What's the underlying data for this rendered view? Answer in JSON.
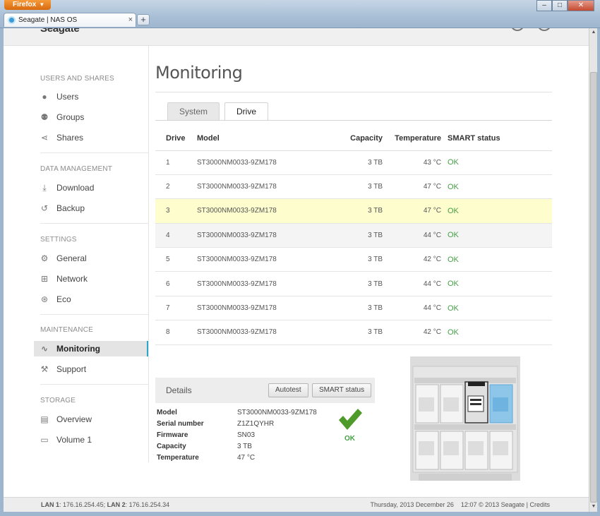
{
  "browser": {
    "app_button": "Firefox",
    "tab_title": "Seagate | NAS OS",
    "tab_close": "×",
    "new_tab": "+",
    "window_controls": [
      "–",
      "□",
      "✕"
    ]
  },
  "header": {
    "logo": "Seagate"
  },
  "sidebar": {
    "sections": [
      {
        "title": "USERS AND SHARES",
        "items": [
          {
            "label": "Users",
            "icon": "user-icon"
          },
          {
            "label": "Groups",
            "icon": "group-icon"
          },
          {
            "label": "Shares",
            "icon": "share-icon"
          }
        ]
      },
      {
        "title": "DATA MANAGEMENT",
        "items": [
          {
            "label": "Download",
            "icon": "download-icon"
          },
          {
            "label": "Backup",
            "icon": "backup-icon"
          }
        ]
      },
      {
        "title": "SETTINGS",
        "items": [
          {
            "label": "General",
            "icon": "gear-icon"
          },
          {
            "label": "Network",
            "icon": "network-icon"
          },
          {
            "label": "Eco",
            "icon": "eco-icon"
          }
        ]
      },
      {
        "title": "MAINTENANCE",
        "items": [
          {
            "label": "Monitoring",
            "icon": "pulse-icon",
            "active": true
          },
          {
            "label": "Support",
            "icon": "wrench-icon"
          }
        ]
      },
      {
        "title": "STORAGE",
        "items": [
          {
            "label": "Overview",
            "icon": "drive-icon"
          },
          {
            "label": "Volume 1",
            "icon": "volume-icon"
          }
        ]
      }
    ]
  },
  "main": {
    "title": "Monitoring",
    "tabs": [
      {
        "label": "System",
        "active": false
      },
      {
        "label": "Drive",
        "active": true
      }
    ],
    "table": {
      "headers": {
        "drive": "Drive",
        "model": "Model",
        "capacity": "Capacity",
        "temperature": "Temperature",
        "smart": "SMART status"
      },
      "rows": [
        {
          "drive": "1",
          "model": "ST3000NM0033-9ZM178",
          "capacity": "3 TB",
          "temperature": "43 °C",
          "smart": "OK"
        },
        {
          "drive": "2",
          "model": "ST3000NM0033-9ZM178",
          "capacity": "3 TB",
          "temperature": "47 °C",
          "smart": "OK"
        },
        {
          "drive": "3",
          "model": "ST3000NM0033-9ZM178",
          "capacity": "3 TB",
          "temperature": "47 °C",
          "smart": "OK",
          "state": "selected"
        },
        {
          "drive": "4",
          "model": "ST3000NM0033-9ZM178",
          "capacity": "3 TB",
          "temperature": "44 °C",
          "smart": "OK",
          "state": "hover"
        },
        {
          "drive": "5",
          "model": "ST3000NM0033-9ZM178",
          "capacity": "3 TB",
          "temperature": "42 °C",
          "smart": "OK"
        },
        {
          "drive": "6",
          "model": "ST3000NM0033-9ZM178",
          "capacity": "3 TB",
          "temperature": "44 °C",
          "smart": "OK"
        },
        {
          "drive": "7",
          "model": "ST3000NM0033-9ZM178",
          "capacity": "3 TB",
          "temperature": "44 °C",
          "smart": "OK"
        },
        {
          "drive": "8",
          "model": "ST3000NM0033-9ZM178",
          "capacity": "3 TB",
          "temperature": "42 °C",
          "smart": "OK"
        }
      ]
    },
    "details": {
      "title": "Details",
      "autotest_button": "Autotest",
      "smart_button": "SMART status",
      "fields": [
        {
          "label": "Model",
          "value": "ST3000NM0033-9ZM178"
        },
        {
          "label": "Serial number",
          "value": "Z1Z1QYHR"
        },
        {
          "label": "Firmware",
          "value": "SN03"
        },
        {
          "label": "Capacity",
          "value": "3 TB"
        },
        {
          "label": "Temperature",
          "value": "47 °C"
        }
      ],
      "status": "OK",
      "status_color": "#46a046"
    }
  },
  "footer": {
    "lan1_label": "LAN 1",
    "lan1_value": ": 176.16.254.45;",
    "lan2_label": "LAN 2",
    "lan2_value": ": 176.16.254.34",
    "datetime": "Thursday, 2013 December 26    12:07",
    "copyright": "© 2013 Seagate | Credits"
  }
}
